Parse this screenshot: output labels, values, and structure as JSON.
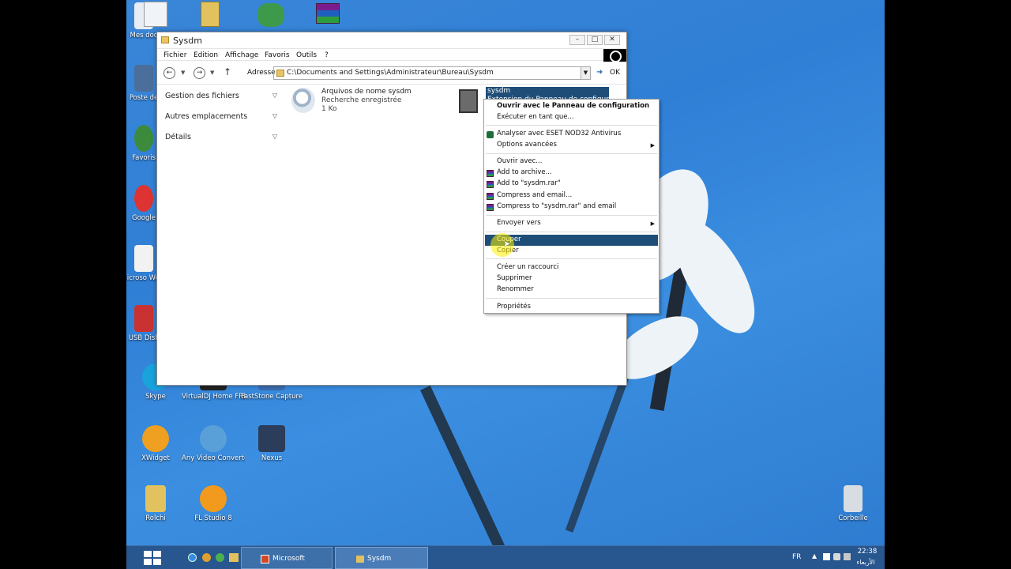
{
  "desktop": {
    "icons": [
      {
        "label": "Mes doc",
        "x": 0
      },
      {
        "label": "Poste de",
        "x": 0
      },
      {
        "label": "Favoris",
        "x": 0
      },
      {
        "label": "Google",
        "x": 0
      },
      {
        "label": "Microso Word",
        "x": 0
      },
      {
        "label": "USB Disk",
        "x": 0
      },
      {
        "label": "Skype"
      },
      {
        "label": "VirtualDJ Home FREE"
      },
      {
        "label": "FastStone Capture"
      },
      {
        "label": "XWidget"
      },
      {
        "label": "Any Video Converter ..."
      },
      {
        "label": "Nexus"
      },
      {
        "label": "Rolchi"
      },
      {
        "label": "FL Studio 8"
      },
      {
        "label": "Corbeille"
      }
    ]
  },
  "window": {
    "title": "Sysdm",
    "menu": [
      "Fichier",
      "Edition",
      "Affichage",
      "Favoris",
      "Outils",
      "?"
    ],
    "address_label": "Adresse",
    "address_value": "C:\\Documents and Settings\\Administrateur\\Bureau\\Sysdm",
    "go_label": "OK",
    "left_pane": [
      "Gestion des fichiers",
      "Autres emplacements",
      "Détails"
    ],
    "files": [
      {
        "name": "Arquivos de nome sysdm",
        "type": "Recherche enregistrée",
        "size": "1 Ko"
      },
      {
        "name": "sysdm",
        "type": "Extension du Panneau de configuration"
      }
    ]
  },
  "context_menu": {
    "items": [
      "Ouvrir avec le Panneau de configuration",
      "Exécuter en tant que...",
      "Analyser avec ESET NOD32 Antivirus",
      "Options avancées",
      "Ouvrir avec...",
      "Add to archive...",
      "Add to \"sysdm.rar\"",
      "Compress and email...",
      "Compress to \"sysdm.rar\" and email",
      "Envoyer vers",
      "Couper",
      "Copier",
      "Créer un raccourci",
      "Supprimer",
      "Renommer",
      "Propriétés"
    ],
    "highlighted": "Couper"
  },
  "taskbar": {
    "tasks": [
      "Microsoft Power...",
      "Sysdm"
    ],
    "language": "FR",
    "time": "22:38",
    "day": "الأربعاء"
  }
}
